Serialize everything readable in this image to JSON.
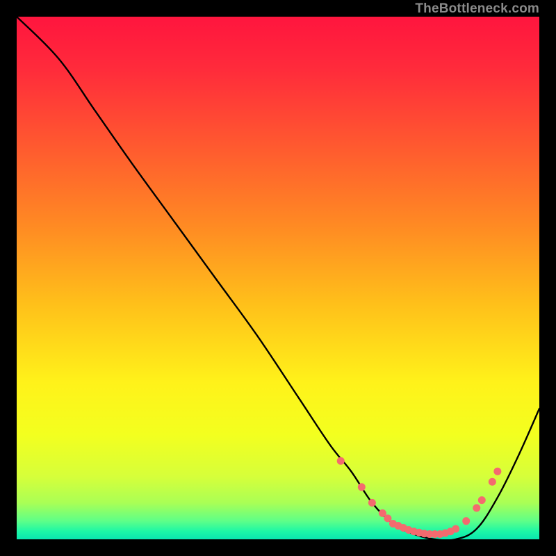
{
  "watermark": "TheBottleneck.com",
  "chart_data": {
    "type": "line",
    "title": "",
    "xlabel": "",
    "ylabel": "",
    "xlim": [
      0,
      100
    ],
    "ylim": [
      0,
      100
    ],
    "background_gradient": {
      "stops": [
        {
          "offset": 0.0,
          "color": "#ff153e"
        },
        {
          "offset": 0.1,
          "color": "#ff2b3b"
        },
        {
          "offset": 0.25,
          "color": "#ff5a2f"
        },
        {
          "offset": 0.4,
          "color": "#ff8a23"
        },
        {
          "offset": 0.55,
          "color": "#ffc01a"
        },
        {
          "offset": 0.7,
          "color": "#fff21a"
        },
        {
          "offset": 0.8,
          "color": "#f3ff1f"
        },
        {
          "offset": 0.88,
          "color": "#d6ff3a"
        },
        {
          "offset": 0.93,
          "color": "#aaff55"
        },
        {
          "offset": 0.965,
          "color": "#5eff88"
        },
        {
          "offset": 0.985,
          "color": "#1cf7a6"
        },
        {
          "offset": 1.0,
          "color": "#0ae6b0"
        }
      ]
    },
    "series": [
      {
        "name": "bottleneck-curve",
        "x": [
          0,
          8,
          15,
          22,
          30,
          38,
          46,
          54,
          60,
          64,
          68,
          72,
          76,
          80,
          84,
          88,
          92,
          96,
          100
        ],
        "y": [
          100,
          92,
          82,
          72,
          61,
          50,
          39,
          27,
          18,
          13,
          7,
          3,
          1,
          0,
          0,
          2,
          8,
          16,
          25
        ]
      }
    ],
    "markers": {
      "name": "highlight-points",
      "color": "#f46a6f",
      "x": [
        62,
        66,
        68,
        70,
        71,
        72,
        73,
        74,
        75,
        76,
        77,
        78,
        79,
        80,
        81,
        82,
        83,
        84,
        86,
        88,
        89,
        91,
        92
      ],
      "y": [
        15,
        10,
        7,
        5,
        4,
        3,
        2.6,
        2.2,
        1.8,
        1.5,
        1.3,
        1.1,
        1.0,
        1.0,
        1.0,
        1.2,
        1.5,
        2.0,
        3.5,
        6,
        7.5,
        11,
        13
      ]
    }
  }
}
